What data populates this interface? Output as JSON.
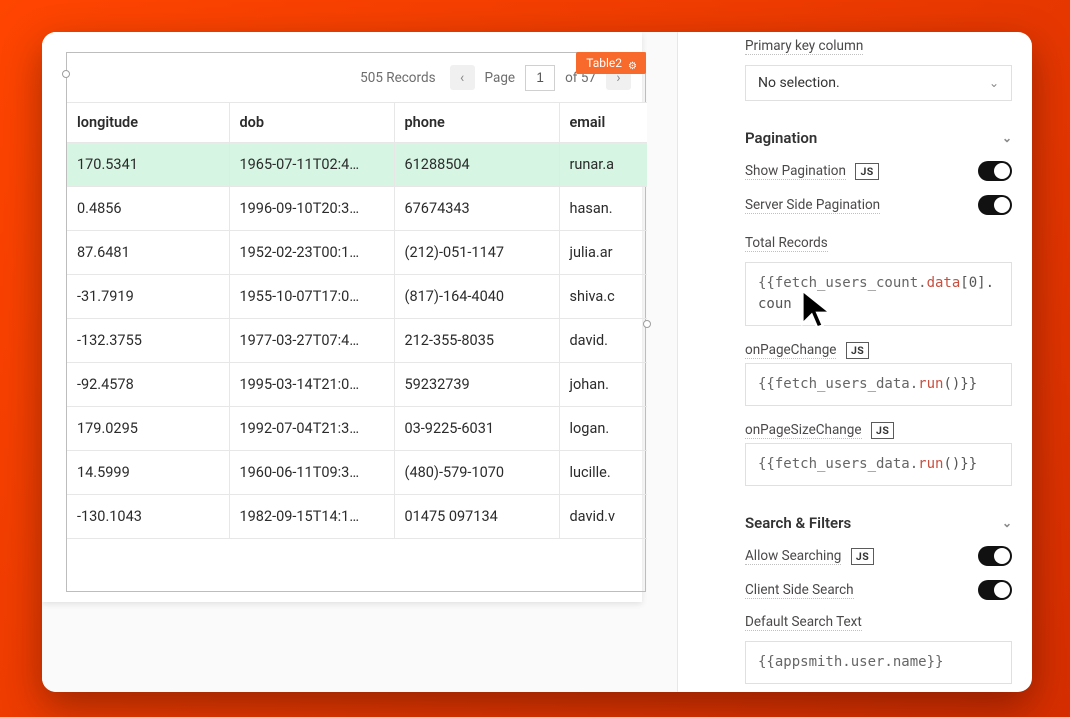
{
  "widget": {
    "name": "Table2",
    "records_label": "505 Records",
    "page_label": "Page",
    "page_number": "1",
    "of_label": "of 57"
  },
  "table": {
    "columns": [
      "longitude",
      "dob",
      "phone",
      "email"
    ],
    "rows": [
      {
        "longitude": "170.5341",
        "dob": "1965-07-11T02:4…",
        "phone": "61288504",
        "email": "runar.a"
      },
      {
        "longitude": "0.4856",
        "dob": "1996-09-10T20:3…",
        "phone": "67674343",
        "email": "hasan."
      },
      {
        "longitude": "87.6481",
        "dob": "1952-02-23T00:1…",
        "phone": "(212)-051-1147",
        "email": "julia.ar"
      },
      {
        "longitude": "-31.7919",
        "dob": "1955-10-07T17:0…",
        "phone": "(817)-164-4040",
        "email": "shiva.c"
      },
      {
        "longitude": "-132.3755",
        "dob": "1977-03-27T07:4…",
        "phone": "212-355-8035",
        "email": "david."
      },
      {
        "longitude": "-92.4578",
        "dob": "1995-03-14T21:0…",
        "phone": "59232739",
        "email": "johan."
      },
      {
        "longitude": "179.0295",
        "dob": "1992-07-04T21:3…",
        "phone": "03-9225-6031",
        "email": "logan."
      },
      {
        "longitude": "14.5999",
        "dob": "1960-06-11T09:3…",
        "phone": "(480)-579-1070",
        "email": "lucille."
      },
      {
        "longitude": "-130.1043",
        "dob": "1982-09-15T14:1…",
        "phone": "01475 097134",
        "email": "david.v"
      }
    ]
  },
  "props": {
    "primary_key_label": "Primary key column",
    "primary_key_value": "No selection.",
    "pagination_header": "Pagination",
    "show_pagination": "Show Pagination",
    "server_side_pagination": "Server Side Pagination",
    "total_records": "Total Records",
    "total_records_code1": "{{fetch_users_count.",
    "total_records_code_attr": "data",
    "total_records_code2": "[0].coun",
    "on_page_change": "onPageChange",
    "on_page_change_code_id": "{{fetch_users_data.",
    "on_page_change_code_attr": "run",
    "on_page_change_code_tail": "()}}",
    "on_page_size_change": "onPageSizeChange",
    "search_header": "Search & Filters",
    "allow_searching": "Allow Searching",
    "client_side_search": "Client Side Search",
    "default_search_text": "Default Search Text",
    "default_search_code": "{{appsmith.user.name}}",
    "js_chip": "JS"
  }
}
